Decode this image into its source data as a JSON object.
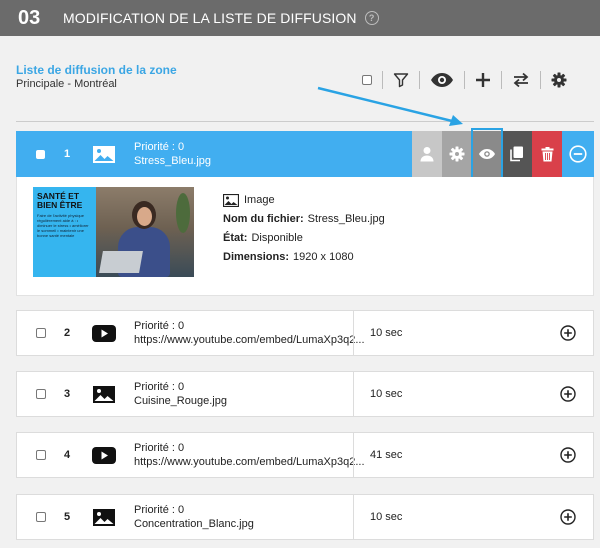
{
  "header": {
    "step": "03",
    "title": "MODIFICATION DE LA LISTE DE DIFFUSION",
    "help_icon": "question-circle-icon"
  },
  "zone": {
    "title": "Liste de diffusion de la zone",
    "subtitle": "Principale - Montréal"
  },
  "toolbar": {
    "icons": [
      "select-all-checkbox",
      "filter-icon",
      "eye-icon",
      "plus-icon",
      "swap-icon",
      "gear-icon"
    ]
  },
  "active_item": {
    "number": "1",
    "priority": "Priorité : 0",
    "name": "Stress_Bleu.jpg",
    "actions": [
      "user-icon",
      "gear-icon",
      "eye-icon",
      "copy-icon",
      "trash-icon",
      "minus-circle-icon"
    ],
    "details": {
      "type_label": "Image",
      "filename_label": "Nom du fichier:",
      "filename_value": "Stress_Bleu.jpg",
      "state_label": "État:",
      "state_value": "Disponible",
      "dimensions_label": "Dimensions:",
      "dimensions_value": "1920 x 1080",
      "thumbnail": {
        "title_line1": "SANTÉ ET",
        "title_line2": "BIEN ÊTRE",
        "small_text": "Faire de l'activité physique régulièrement aide à : • diminuer le stress • améliorer le sommeil • maintenir une bonne santé mentale"
      }
    }
  },
  "items": [
    {
      "number": "2",
      "priority": "Priorité : 0",
      "name": "https://www.youtube.com/embed/LumaXp3q2...",
      "duration": "10 sec",
      "type": "video"
    },
    {
      "number": "3",
      "priority": "Priorité : 0",
      "name": "Cuisine_Rouge.jpg",
      "duration": "10 sec",
      "type": "image"
    },
    {
      "number": "4",
      "priority": "Priorité : 0",
      "name": "https://www.youtube.com/embed/LumaXp3q2...",
      "duration": "41 sec",
      "type": "video"
    },
    {
      "number": "5",
      "priority": "Priorité : 0",
      "name": "Concentration_Blanc.jpg",
      "duration": "10 sec",
      "type": "image"
    }
  ],
  "colors": {
    "accent": "#41aef0",
    "header": "#6b6b6b",
    "delete": "#d9404a"
  }
}
